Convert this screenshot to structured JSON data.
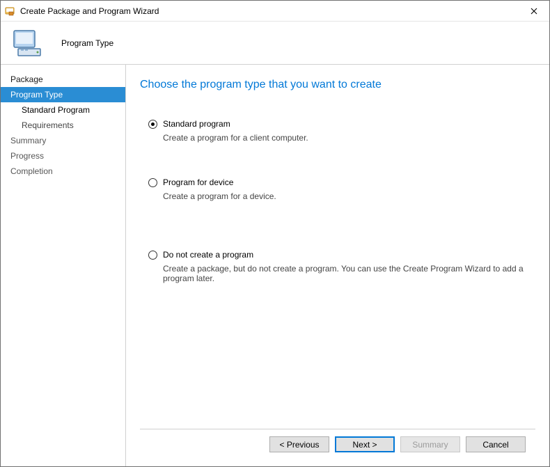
{
  "window": {
    "title": "Create Package and Program Wizard"
  },
  "header": {
    "title": "Program Type"
  },
  "sidebar": {
    "items": [
      {
        "label": "Package"
      },
      {
        "label": "Program Type"
      },
      {
        "label": "Standard Program"
      },
      {
        "label": "Requirements"
      },
      {
        "label": "Summary"
      },
      {
        "label": "Progress"
      },
      {
        "label": "Completion"
      }
    ]
  },
  "main": {
    "heading": "Choose the program type that you want to create",
    "options": [
      {
        "label": "Standard program",
        "desc": "Create a program for a client computer.",
        "checked": true
      },
      {
        "label": "Program for device",
        "desc": "Create a program for a device.",
        "checked": false
      },
      {
        "label": "Do not create a program",
        "desc": "Create a package, but do not create a program. You can use the Create Program Wizard to add a program later.",
        "checked": false
      }
    ]
  },
  "footer": {
    "previous": "< Previous",
    "next": "Next >",
    "summary": "Summary",
    "cancel": "Cancel"
  }
}
